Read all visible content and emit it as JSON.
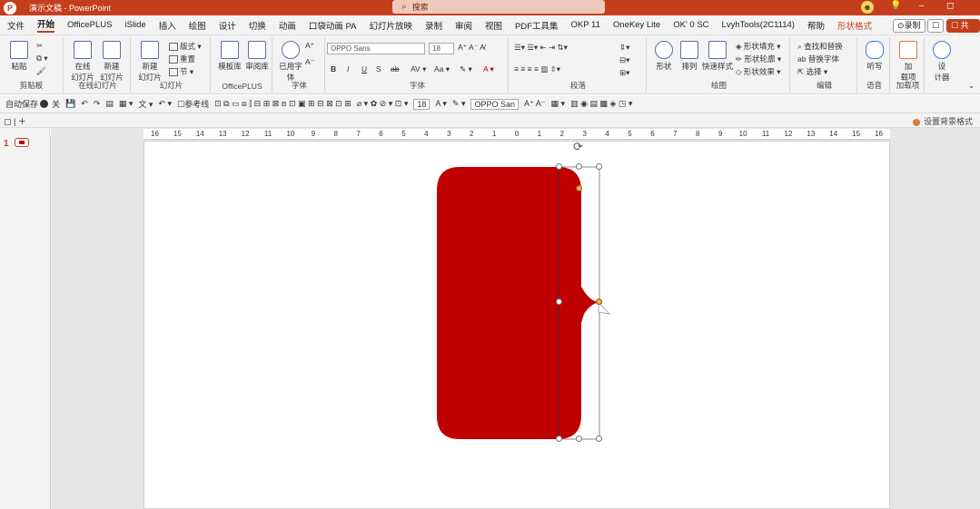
{
  "titlebar": {
    "doc_title": "演示文稿 - PowerPoint",
    "search_label": "搜索",
    "avatar_glyph": "☻"
  },
  "menu_tabs": [
    "文件",
    "开始",
    "OfficePLUS",
    "iSlide",
    "插入",
    "绘图",
    "设计",
    "切换",
    "动画",
    "口袋动画 PA",
    "幻灯片放映",
    "录制",
    "审阅",
    "视图",
    "PDF工具集",
    "OKP 11",
    "OneKey Lite",
    "OK' 0 SC",
    "LvyhTools(2C1114)",
    "帮助",
    "形状格式"
  ],
  "menu_right": {
    "record": "⊙录制",
    "comment": "☐",
    "share": "☐ 共享"
  },
  "ribbon": {
    "clipboard": {
      "label": "剪贴板",
      "paste": "粘贴"
    },
    "officeplus_new": {
      "label": "在线幻灯片",
      "btn1": "在线\n幻灯片",
      "btn2": "新建\n幻灯片"
    },
    "slides": {
      "label": "幻灯片",
      "new_slide": "新建\n幻灯片",
      "layout": "版式 ▾",
      "reset": "重置",
      "section": "节 ▾"
    },
    "officeplus": {
      "label": "OfficePLUS",
      "btn1": "模板库",
      "btn2": "审阅库"
    },
    "font_font": {
      "label": "字体",
      "font_name": "OPPO Sans",
      "font_size": "18"
    },
    "use_font": "已用字\n体",
    "paragraph": {
      "label": "段落"
    },
    "drawing": {
      "label": "绘图",
      "shapes": "形状",
      "arrange": "排列",
      "quick_styles": "快速样式",
      "fill": "形状填充 ▾",
      "outline": "形状轮廓 ▾",
      "effects": "形状效果 ▾"
    },
    "editing": {
      "label": "编辑",
      "find": "查找和替换",
      "replace": "替换字体",
      "select": "选择 ▾"
    },
    "voice": {
      "label": "语音",
      "dictate": "听写"
    },
    "addins": {
      "label": "加载项",
      "btn": "加\n载项"
    },
    "design_ideas": {
      "label": "",
      "btn": "设\n计器"
    }
  },
  "qat": {
    "autosave": "自动保存",
    "autosave_state": "关",
    "divider_label": "参考线",
    "font_box": "OPPO San",
    "size_box": "18"
  },
  "navbar": {
    "format_bg": "设置背景格式"
  },
  "thumbs": {
    "slide_num": "1"
  },
  "ruler": {
    "ticks": [
      "16",
      "15",
      "14",
      "13",
      "12",
      "11",
      "10",
      "9",
      "8",
      "7",
      "6",
      "5",
      "4",
      "3",
      "2",
      "1",
      "0",
      "1",
      "2",
      "3",
      "4",
      "5",
      "6",
      "7",
      "8",
      "9",
      "10",
      "11",
      "12",
      "13",
      "14",
      "15",
      "16"
    ]
  },
  "colors": {
    "accent": "#c43e1c",
    "shape_red": "#c00000"
  }
}
